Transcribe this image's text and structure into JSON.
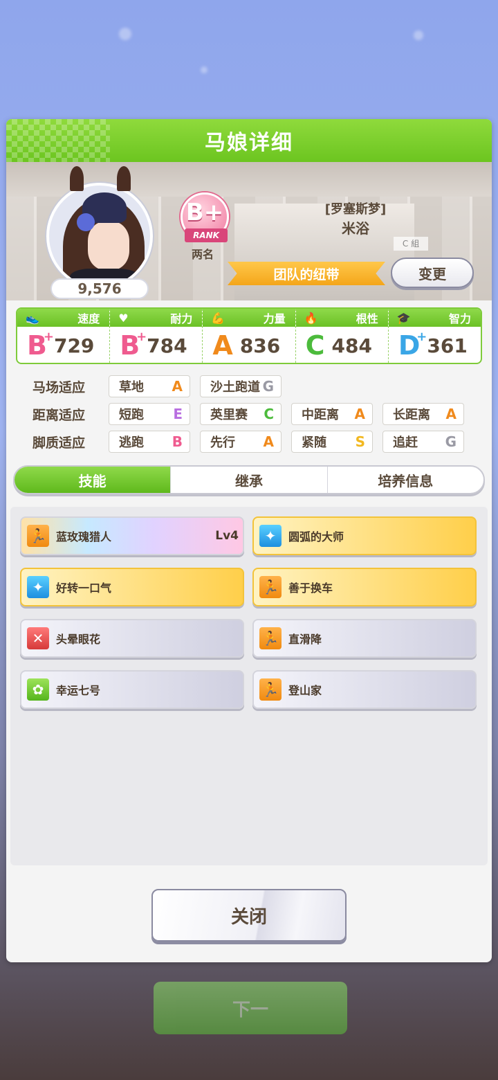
{
  "header": {
    "title": "马娘详细"
  },
  "profile": {
    "score": "9,576",
    "rank_letter": "B+",
    "rank_label": "RANK",
    "rank_sub": "两名",
    "epithet": "[罗塞斯梦]",
    "name": "米浴",
    "group_tag": "C 組",
    "team_ribbon": "团队的纽带",
    "change_button": "变更"
  },
  "stats": [
    {
      "label": "速度",
      "icon": "shoe-icon",
      "glyph": "👟",
      "grade": "B",
      "plus": "+",
      "grade_color": "#ef5b8f",
      "value": "729"
    },
    {
      "label": "耐力",
      "icon": "heart-icon",
      "glyph": "♥",
      "grade": "B",
      "plus": "+",
      "grade_color": "#ef5b8f",
      "value": "784"
    },
    {
      "label": "力量",
      "icon": "muscle-icon",
      "glyph": "💪",
      "grade": "A",
      "plus": "",
      "grade_color": "#f08a1c",
      "value": "836"
    },
    {
      "label": "根性",
      "icon": "flame-icon",
      "glyph": "🔥",
      "grade": "C",
      "plus": "",
      "grade_color": "#4cbb3c",
      "value": "484"
    },
    {
      "label": "智力",
      "icon": "graduation-cap-icon",
      "glyph": "🎓",
      "grade": "D",
      "plus": "+",
      "grade_color": "#3aa6e6",
      "value": "361"
    }
  ],
  "aptitude": {
    "track": {
      "label": "马场适应",
      "items": [
        {
          "name": "草地",
          "grade": "A",
          "color": "#f08a1c"
        },
        {
          "name": "沙土跑道",
          "grade": "G",
          "color": "#9a9aa4"
        }
      ]
    },
    "distance": {
      "label": "距离适应",
      "items": [
        {
          "name": "短跑",
          "grade": "E",
          "color": "#b86ee0"
        },
        {
          "name": "英里赛",
          "grade": "C",
          "color": "#4cbb3c"
        },
        {
          "name": "中距离",
          "grade": "A",
          "color": "#f08a1c"
        },
        {
          "name": "长距离",
          "grade": "A",
          "color": "#f08a1c"
        }
      ]
    },
    "style": {
      "label": "脚质适应",
      "items": [
        {
          "name": "逃跑",
          "grade": "B",
          "color": "#ef5b8f"
        },
        {
          "name": "先行",
          "grade": "A",
          "color": "#f08a1c"
        },
        {
          "name": "紧随",
          "grade": "S",
          "color": "#f2b820"
        },
        {
          "name": "追赶",
          "grade": "G",
          "color": "#9a9aa4"
        }
      ]
    }
  },
  "tabs": [
    "技能",
    "继承",
    "培养信息"
  ],
  "skills": [
    {
      "name": "蓝玫瑰猎人",
      "level": "Lv4",
      "style": "rainbow",
      "icon": "runner-icon",
      "icon_color": "ic-orange"
    },
    {
      "name": "圆弧的大师",
      "level": "",
      "style": "gold",
      "icon": "sparkle-icon",
      "icon_color": "ic-blue"
    },
    {
      "name": "好转一口气",
      "level": "",
      "style": "gold",
      "icon": "sparkle-icon",
      "icon_color": "ic-blue"
    },
    {
      "name": "善于换车",
      "level": "",
      "style": "gold",
      "icon": "runner-icon",
      "icon_color": "ic-orange"
    },
    {
      "name": "头晕眼花",
      "level": "",
      "style": "normal",
      "icon": "debuff-icon",
      "icon_color": "ic-red"
    },
    {
      "name": "直滑降",
      "level": "",
      "style": "normal",
      "icon": "runner-icon",
      "icon_color": "ic-orange"
    },
    {
      "name": "幸运七号",
      "level": "",
      "style": "normal",
      "icon": "clover-icon",
      "icon_color": "ic-green"
    },
    {
      "name": "登山家",
      "level": "",
      "style": "normal",
      "icon": "runner-icon",
      "icon_color": "ic-orange"
    }
  ],
  "close_button": "关闭",
  "background_button": "下一"
}
